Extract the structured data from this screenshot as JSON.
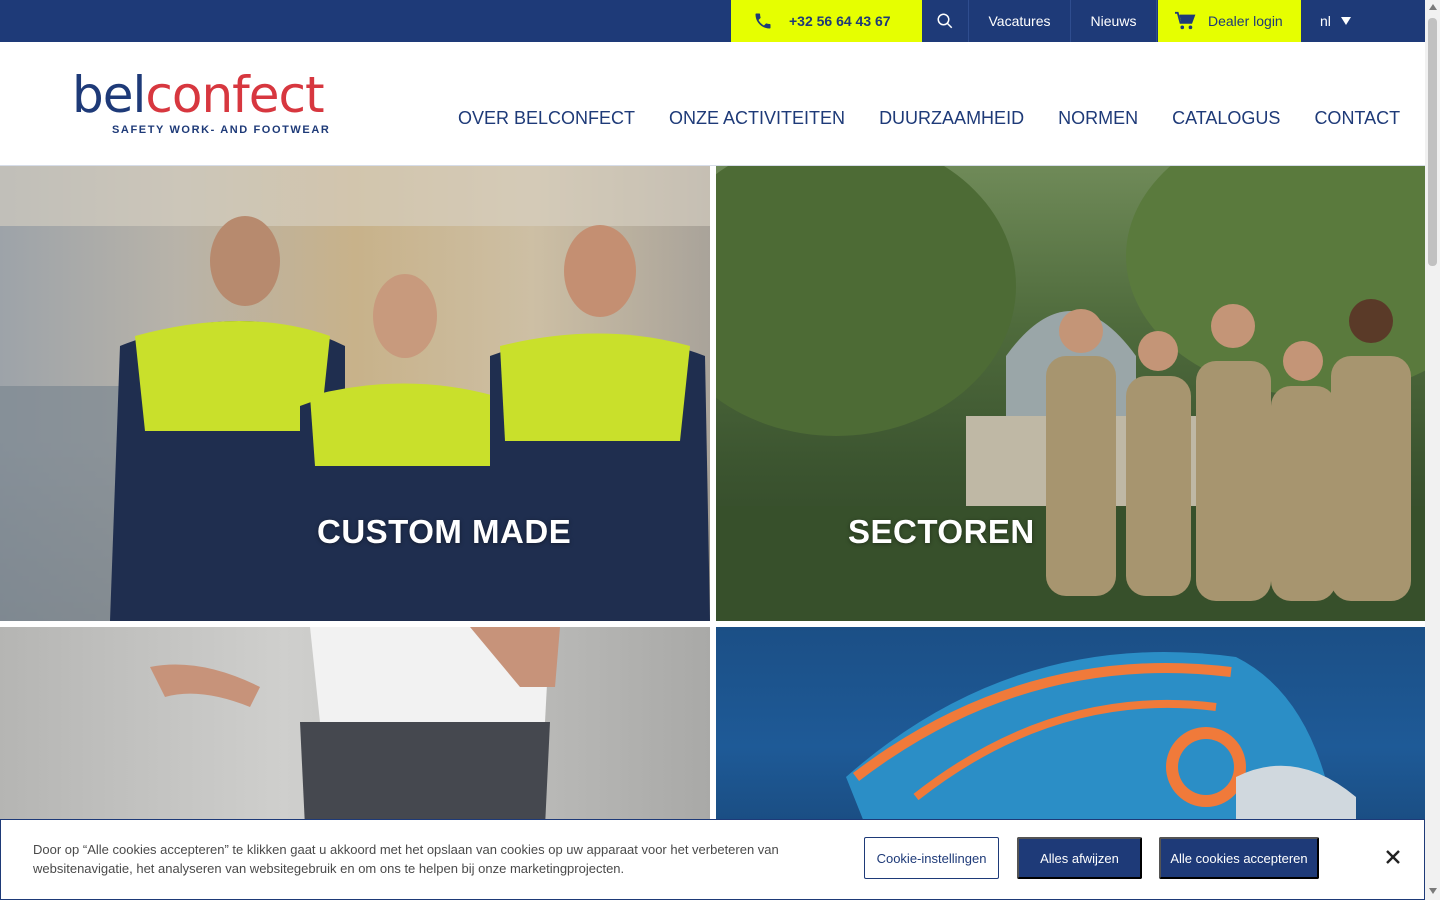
{
  "topbar": {
    "phone": "+32 56 64 43 67",
    "phone_icon": "phone-icon",
    "search_icon": "search-icon",
    "links": [
      "Vacatures",
      "Nieuws"
    ],
    "dealer_login": "Dealer login",
    "cart_icon": "cart-icon",
    "language": "nl"
  },
  "header": {
    "logo": {
      "part1": "bel",
      "part2": "confect",
      "tagline": "SAFETY WORK- AND FOOTWEAR"
    },
    "nav": [
      "OVER BELCONFECT",
      "ONZE ACTIVITEITEN",
      "DUURZAAMHEID",
      "NORMEN",
      "CATALOGUS",
      "CONTACT"
    ]
  },
  "tiles": [
    {
      "label": "CUSTOM MADE"
    },
    {
      "label": "SECTOREN"
    },
    {
      "label": ""
    },
    {
      "label": ""
    }
  ],
  "cookie": {
    "text": "Door op “Alle cookies accepteren” te klikken gaat u akkoord met het opslaan van cookies op uw apparaat voor het verbeteren van websitenavigatie, het analyseren van websitegebruik en om ons te helpen bij onze marketingprojecten.",
    "settings_label": "Cookie-instellingen",
    "reject_label": "Alles afwijzen",
    "accept_label": "Alle cookies accepteren",
    "close_icon": "close-icon"
  },
  "colors": {
    "navy": "#1e3a78",
    "lime": "#e6ff00",
    "red": "#d7373f"
  }
}
